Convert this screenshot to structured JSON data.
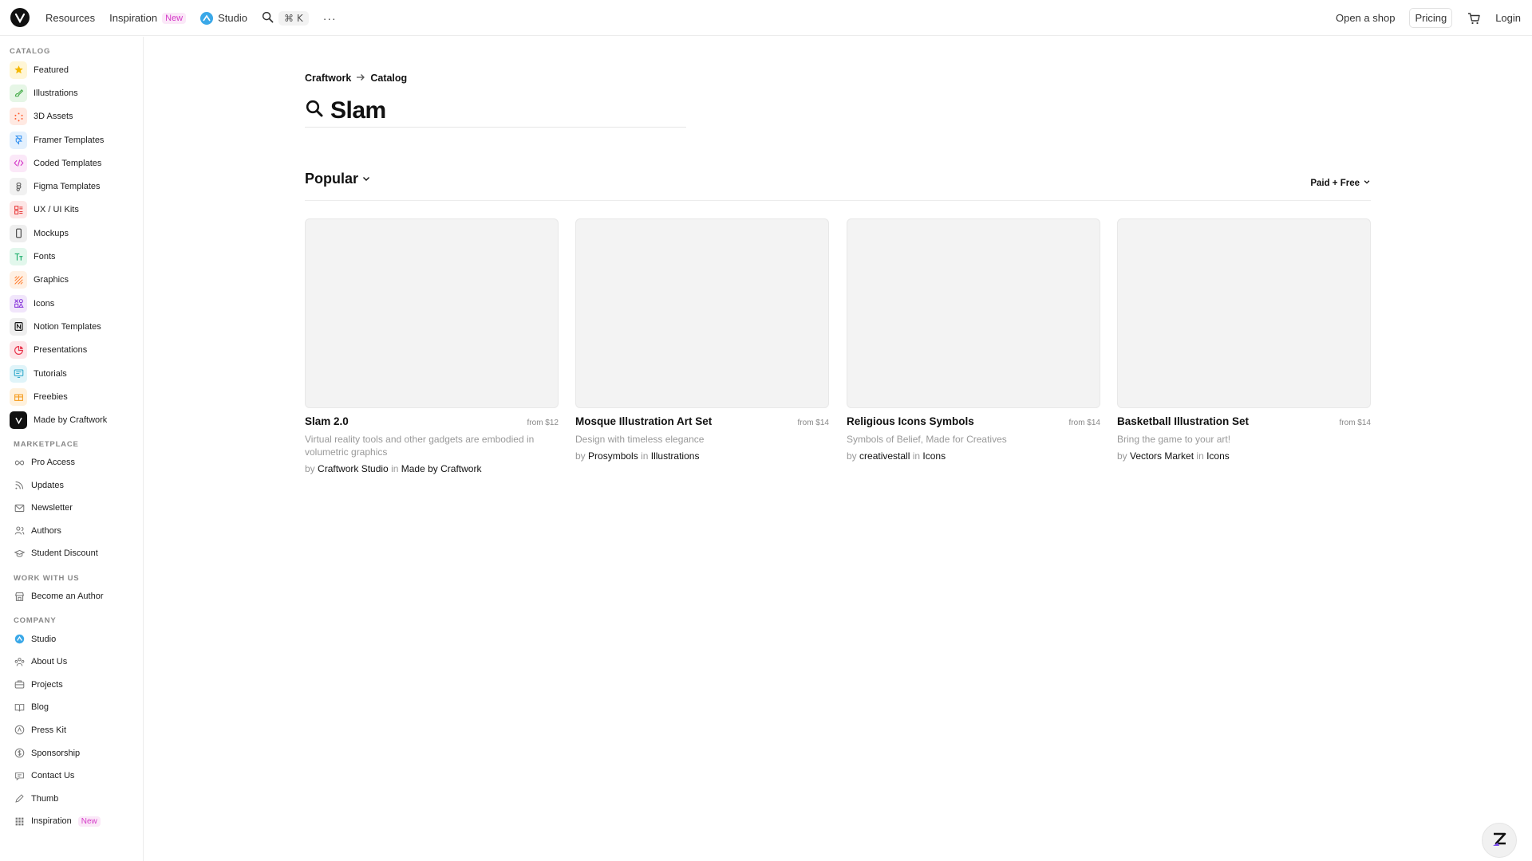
{
  "topbar": {
    "nav": [
      {
        "label": "Resources"
      },
      {
        "label": "Inspiration",
        "badge": "New"
      },
      {
        "label": "Studio"
      }
    ],
    "search_shortcut": "⌘ K",
    "more": "···",
    "right": {
      "open_shop": "Open a shop",
      "pricing": "Pricing",
      "login": "Login"
    }
  },
  "sidebar": {
    "catalog_title": "CATALOG",
    "catalog": [
      {
        "label": "Featured",
        "icon": "star-icon",
        "color": "#f5b800",
        "bg": "#fff6d6"
      },
      {
        "label": "Illustrations",
        "icon": "brush-icon",
        "color": "#4caf50",
        "bg": "#e6f6e6"
      },
      {
        "label": "3D Assets",
        "icon": "cube-icon",
        "color": "#ff5a2a",
        "bg": "#ffe9e2"
      },
      {
        "label": "Framer Templates",
        "icon": "framer-icon",
        "color": "#2f8ef0",
        "bg": "#e3f0fd"
      },
      {
        "label": "Coded Templates",
        "icon": "code-icon",
        "color": "#d43ac8",
        "bg": "#fbe8f8"
      },
      {
        "label": "Figma Templates",
        "icon": "figma-icon",
        "color": "#555555",
        "bg": "#f1f1f1"
      },
      {
        "label": "UX / UI Kits",
        "icon": "layout-icon",
        "color": "#e83a3a",
        "bg": "#fde6e6"
      },
      {
        "label": "Mockups",
        "icon": "phone-icon",
        "color": "#444444",
        "bg": "#eeeeee"
      },
      {
        "label": "Fonts",
        "icon": "type-icon",
        "color": "#1cae6b",
        "bg": "#e2f7ec"
      },
      {
        "label": "Graphics",
        "icon": "stripes-icon",
        "color": "#ff7a2a",
        "bg": "#fff0e3"
      },
      {
        "label": "Icons",
        "icon": "shapes-icon",
        "color": "#8a3adb",
        "bg": "#f1e6fb"
      },
      {
        "label": "Notion Templates",
        "icon": "notion-icon",
        "color": "#111111",
        "bg": "#eeeeee"
      },
      {
        "label": "Presentations",
        "icon": "pie-icon",
        "color": "#e8334a",
        "bg": "#fde4e8"
      },
      {
        "label": "Tutorials",
        "icon": "screen-icon",
        "color": "#2aa7c9",
        "bg": "#e0f4f9"
      },
      {
        "label": "Freebies",
        "icon": "gift-icon",
        "color": "#f59a1a",
        "bg": "#fff1dc"
      },
      {
        "label": "Made by Craftwork",
        "icon": "craftwork-icon",
        "color": "#ffffff",
        "bg": "#111111"
      }
    ],
    "marketplace_title": "MARKETPLACE",
    "marketplace": [
      {
        "label": "Pro Access",
        "icon": "infinity-icon"
      },
      {
        "label": "Updates",
        "icon": "rss-icon"
      },
      {
        "label": "Newsletter",
        "icon": "mail-icon"
      },
      {
        "label": "Authors",
        "icon": "users-icon"
      },
      {
        "label": "Student Discount",
        "icon": "graduation-icon"
      }
    ],
    "work_title": "WORK WITH US",
    "work": [
      {
        "label": "Become an Author",
        "icon": "store-icon"
      }
    ],
    "company_title": "COMPANY",
    "company": [
      {
        "label": "Studio",
        "icon": "studio-icon"
      },
      {
        "label": "About Us",
        "icon": "team-icon"
      },
      {
        "label": "Projects",
        "icon": "briefcase-icon"
      },
      {
        "label": "Blog",
        "icon": "book-icon"
      },
      {
        "label": "Press Kit",
        "icon": "press-icon"
      },
      {
        "label": "Sponsorship",
        "icon": "dollar-icon"
      },
      {
        "label": "Contact Us",
        "icon": "chat-icon"
      },
      {
        "label": "Thumb",
        "icon": "pen-icon"
      },
      {
        "label": "Inspiration",
        "icon": "grid-icon",
        "badge": "New"
      }
    ]
  },
  "breadcrumb": {
    "root": "Craftwork",
    "current": "Catalog"
  },
  "search": {
    "query": "Slam"
  },
  "section": {
    "sort_label": "Popular",
    "filter_label": "Paid + Free"
  },
  "products": [
    {
      "title": "Slam 2.0",
      "price": "from $12",
      "description": "Virtual reality tools and other gadgets are embodied in volumetric graphics",
      "by": "by",
      "author": "Craftwork Studio",
      "in": "in",
      "category": "Made by Craftwork"
    },
    {
      "title": "Mosque Illustration Art Set",
      "price": "from $14",
      "description": "Design with timeless elegance",
      "by": "by",
      "author": "Prosymbols",
      "in": "in",
      "category": "Illustrations"
    },
    {
      "title": "Religious Icons Symbols",
      "price": "from $14",
      "description": "Symbols of Belief, Made for Creatives",
      "by": "by",
      "author": "creativestall",
      "in": "in",
      "category": "Icons"
    },
    {
      "title": "Basketball Illustration Set",
      "price": "from $14",
      "description": "Bring the game to your art!",
      "by": "by",
      "author": "Vectors Market",
      "in": "in",
      "category": "Icons"
    }
  ]
}
